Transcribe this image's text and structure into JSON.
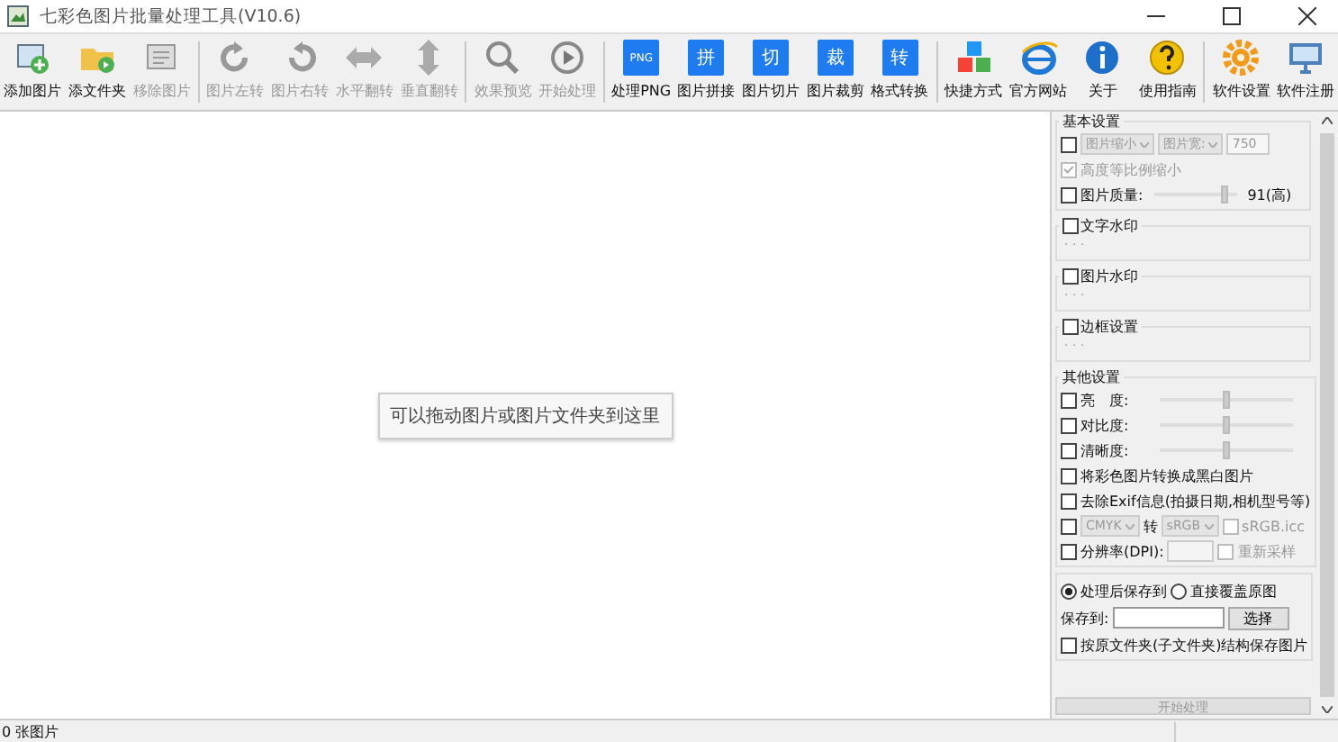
{
  "window": {
    "title": "七彩色图片批量处理工具(V10.6)"
  },
  "toolbar": [
    {
      "kind": "plus",
      "label": "添加图片",
      "disabled": false,
      "separator_after": false
    },
    {
      "kind": "folder",
      "label": "添文件夹",
      "disabled": false,
      "separator_after": false
    },
    {
      "kind": "remove",
      "label": "移除图片",
      "disabled": true,
      "separator_after": true
    },
    {
      "kind": "rotleft",
      "label": "图片左转",
      "disabled": true,
      "separator_after": false
    },
    {
      "kind": "rotright",
      "label": "图片右转",
      "disabled": true,
      "separator_after": false
    },
    {
      "kind": "fliph",
      "label": "水平翻转",
      "disabled": true,
      "separator_after": false
    },
    {
      "kind": "flipv",
      "label": "垂直翻转",
      "disabled": true,
      "separator_after": true
    },
    {
      "kind": "search",
      "label": "效果预览",
      "disabled": true,
      "separator_after": false
    },
    {
      "kind": "play",
      "label": "开始处理",
      "disabled": true,
      "separator_after": true
    },
    {
      "kind": "tile",
      "tile": "PNG",
      "label": "处理PNG",
      "disabled": false,
      "separator_after": false
    },
    {
      "kind": "tile",
      "tile": "拼",
      "label": "图片拼接",
      "disabled": false,
      "separator_after": false
    },
    {
      "kind": "tile",
      "tile": "切",
      "label": "图片切片",
      "disabled": false,
      "separator_after": false
    },
    {
      "kind": "tile",
      "tile": "裁",
      "label": "图片裁剪",
      "disabled": false,
      "separator_after": false
    },
    {
      "kind": "tile",
      "tile": "转",
      "label": "格式转换",
      "disabled": false,
      "separator_after": true
    },
    {
      "kind": "cubes",
      "label": "快捷方式",
      "disabled": false,
      "separator_after": false
    },
    {
      "kind": "globe",
      "label": "官方网站",
      "disabled": false,
      "separator_after": false
    },
    {
      "kind": "info",
      "label": "关于",
      "disabled": false,
      "separator_after": false
    },
    {
      "kind": "help",
      "label": "使用指南",
      "disabled": false,
      "separator_after": true
    },
    {
      "kind": "gear",
      "label": "软件设置",
      "disabled": false,
      "separator_after": false
    },
    {
      "kind": "monitor",
      "label": "软件注册",
      "disabled": false,
      "separator_after": false
    }
  ],
  "drop_hint": "可以拖动图片或图片文件夹到这里",
  "basic": {
    "title": "基本设置",
    "resize_checked": false,
    "resize_mode": "图片缩小",
    "resize_by": "图片宽:",
    "size": "750",
    "keep_ratio": {
      "label": "高度等比例缩小",
      "checked": true
    },
    "quality": {
      "label": "图片质量:",
      "checked": false,
      "level": 0.85,
      "reading": "91(高)"
    }
  },
  "groups": [
    {
      "label": "文字水印",
      "checked": false,
      "dots": "· · ·"
    },
    {
      "label": "图片水印",
      "checked": false,
      "dots": "· · ·"
    },
    {
      "label": "边框设置",
      "checked": false,
      "dots": "· · ·"
    }
  ],
  "other": {
    "title": "其他设置",
    "sliders": [
      {
        "label": "亮　度:",
        "checked": false,
        "level": 0.5
      },
      {
        "label": "对比度:",
        "checked": false,
        "level": 0.5
      },
      {
        "label": "清晰度:",
        "checked": false,
        "level": 0.5
      }
    ],
    "options": [
      {
        "label": "将彩色图片转换成黑白图片",
        "checked": false
      },
      {
        "label": "去除Exif信息(拍摄日期,相机型号等)",
        "checked": false
      }
    ],
    "convert": {
      "checked": false,
      "from": "CMYK",
      "joiner": "转",
      "to": "sRGB",
      "icc": {
        "label": "sRGB.icc",
        "checked": false
      }
    },
    "dpi": {
      "label": "分辨率(DPI):",
      "checked": false,
      "resample": {
        "label": "重新采样",
        "checked": false
      }
    }
  },
  "save": {
    "modes": [
      {
        "label": "处理后保存到",
        "selected": true
      },
      {
        "label": "直接覆盖原图",
        "selected": false
      }
    ],
    "path_label": "保存到:",
    "browse": "选择",
    "keep_structure": {
      "label": "按原文件夹(子文件夹)结构保存图片",
      "checked": false
    }
  },
  "start_button": {
    "label": "开始处理",
    "disabled": true
  },
  "status_bar": {
    "count": "0 张图片"
  }
}
